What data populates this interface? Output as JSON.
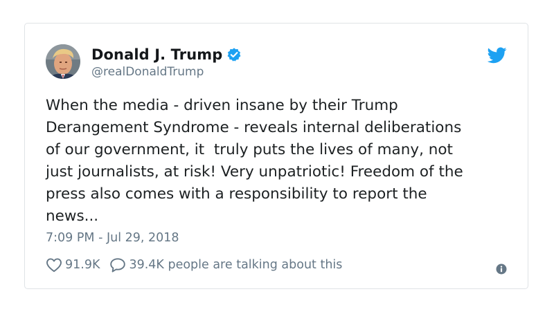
{
  "author": {
    "display_name": "Donald J. Trump",
    "handle": "@realDonaldTrump",
    "verified": true,
    "avatar_icon": "profile-photo"
  },
  "tweet": {
    "text": "When the media - driven insane by their Trump\nDerangement Syndrome - reveals internal deliberations\nof our government, it  truly puts the lives of many, not\njust journalists, at risk! Very unpatriotic! Freedom of the\npress also comes with a responsibility to report the\nnews...",
    "timestamp": "7:09 PM - Jul 29, 2018"
  },
  "stats": {
    "likes": "91.9K",
    "conversation": "39.4K people are talking about this"
  },
  "icons": {
    "brand": "twitter-bird-icon",
    "verified": "verified-badge-icon",
    "like": "heart-icon",
    "reply": "speech-bubble-icon",
    "info": "info-icon"
  },
  "colors": {
    "brand_blue": "#1da1f2",
    "secondary_text": "#657786",
    "border": "#dfe3e6"
  }
}
